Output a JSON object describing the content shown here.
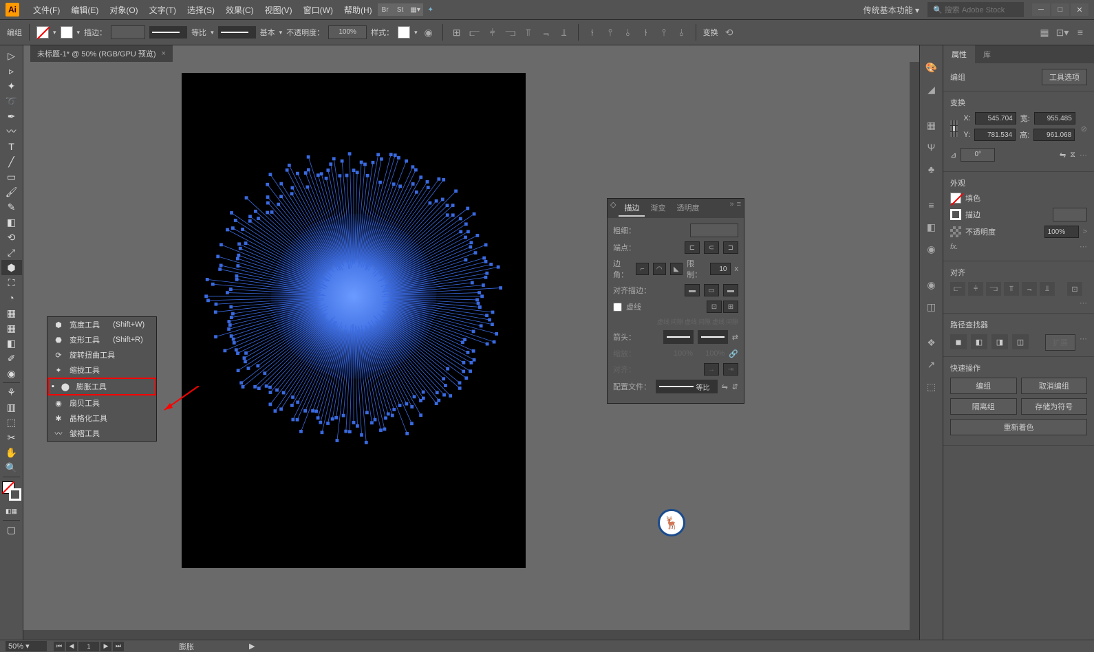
{
  "menubar": {
    "logo": "Ai",
    "items": [
      "文件(F)",
      "编辑(E)",
      "对象(O)",
      "文字(T)",
      "选择(S)",
      "效果(C)",
      "视图(V)",
      "窗口(W)",
      "帮助(H)"
    ],
    "workspace": "传统基本功能",
    "search_placeholder": "搜索 Adobe Stock"
  },
  "controlbar": {
    "selection_label": "编组",
    "stroke_label": "描边：",
    "uniform": "等比",
    "basic": "基本",
    "opacity_label": "不透明度：",
    "opacity_value": "100%",
    "style_label": "样式：",
    "transform_label": "变换"
  },
  "document": {
    "tab_title": "未标题-1* @ 50% (RGB/GPU 预览)"
  },
  "flyout": {
    "items": [
      {
        "label": "宽度工具",
        "shortcut": "(Shift+W)"
      },
      {
        "label": "变形工具",
        "shortcut": "(Shift+R)"
      },
      {
        "label": "旋转扭曲工具",
        "shortcut": ""
      },
      {
        "label": "缩拢工具",
        "shortcut": ""
      },
      {
        "label": "膨胀工具",
        "shortcut": ""
      },
      {
        "label": "扇贝工具",
        "shortcut": ""
      },
      {
        "label": "晶格化工具",
        "shortcut": ""
      },
      {
        "label": "皱褶工具",
        "shortcut": ""
      }
    ]
  },
  "stroke_panel": {
    "tabs": [
      "描边",
      "渐变",
      "透明度"
    ],
    "weight_label": "粗细：",
    "cap_label": "端点：",
    "corner_label": "边角：",
    "limit_label": "限制：",
    "limit_value": "10",
    "limit_unit": "x",
    "align_label": "对齐描边：",
    "dashed_label": "虚线",
    "dash_cols": [
      "虚线",
      "间隙",
      "虚线",
      "间隙",
      "虚线",
      "间隙"
    ],
    "arrow_label": "箭头：",
    "scale_label": "缩放：",
    "scale_a": "100%",
    "scale_b": "100%",
    "align_arrow_label": "对齐：",
    "profile_label": "配置文件：",
    "profile_value": "等比"
  },
  "properties": {
    "tabs": [
      "属性",
      "库"
    ],
    "selection_type": "编组",
    "options_btn": "工具选项",
    "transform_title": "变换",
    "x_label": "X:",
    "x_value": "545.704",
    "y_label": "Y:",
    "y_value": "781.534",
    "w_label": "宽:",
    "w_value": "955.485",
    "h_label": "高:",
    "h_value": "961.068",
    "angle_value": "0°",
    "appearance_title": "外观",
    "fill_label": "填色",
    "stroke_label": "描边",
    "opacity_label": "不透明度",
    "opacity_value": "100%",
    "fx_label": "fx.",
    "align_title": "对齐",
    "pathfinder_title": "路径查找器",
    "expand_btn": "扩展",
    "quick_title": "快速操作",
    "group_btn": "编组",
    "ungroup_btn": "取消编组",
    "isolate_btn": "隔离组",
    "save_symbol_btn": "存储为符号",
    "recolor_btn": "重新着色"
  },
  "statusbar": {
    "zoom": "50%",
    "page": "1",
    "tool_name": "膨胀"
  }
}
